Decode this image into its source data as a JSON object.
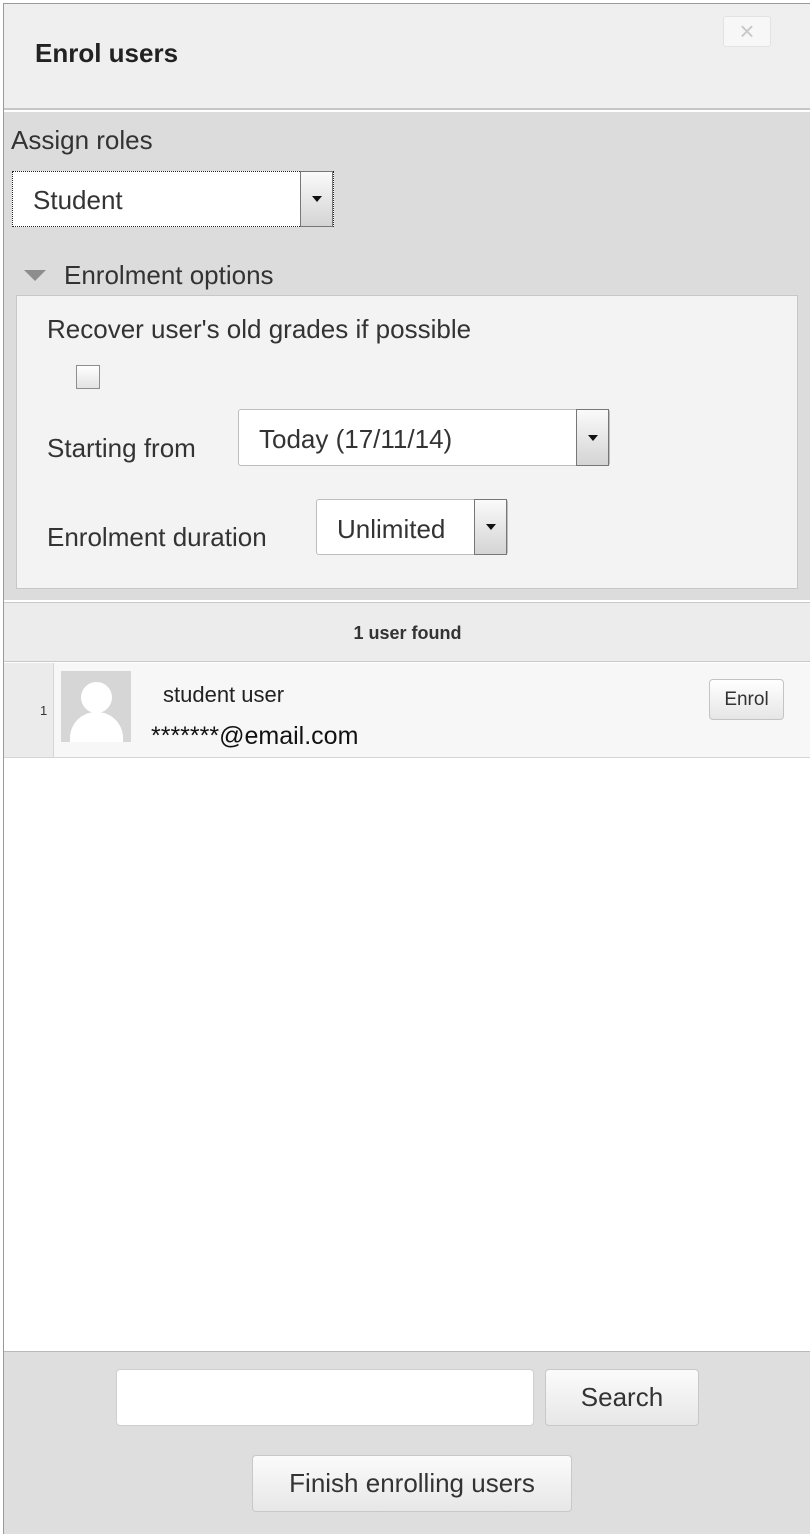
{
  "dialog": {
    "title": "Enrol users",
    "close_label": "×"
  },
  "assign_roles": {
    "label": "Assign roles",
    "selected": "Student"
  },
  "enrolment_options": {
    "legend": "Enrolment options",
    "recover_grades_label": "Recover user's old grades if possible",
    "recover_grades_checked": false,
    "starting_from_label": "Starting from",
    "starting_from_value": "Today (17/11/14)",
    "duration_label": "Enrolment duration",
    "duration_value": "Unlimited"
  },
  "results": {
    "count_text": "1 user found",
    "users": [
      {
        "index": "1",
        "name": "student user",
        "email": "*******@email.com",
        "enrol_label": "Enrol"
      }
    ]
  },
  "footer": {
    "search_value": "",
    "search_label": "Search",
    "finish_label": "Finish enrolling users"
  },
  "icons": {
    "close": "close-icon",
    "dropdown": "chevron-down-icon",
    "collapse": "triangle-down-icon",
    "avatar": "user-avatar-icon"
  }
}
